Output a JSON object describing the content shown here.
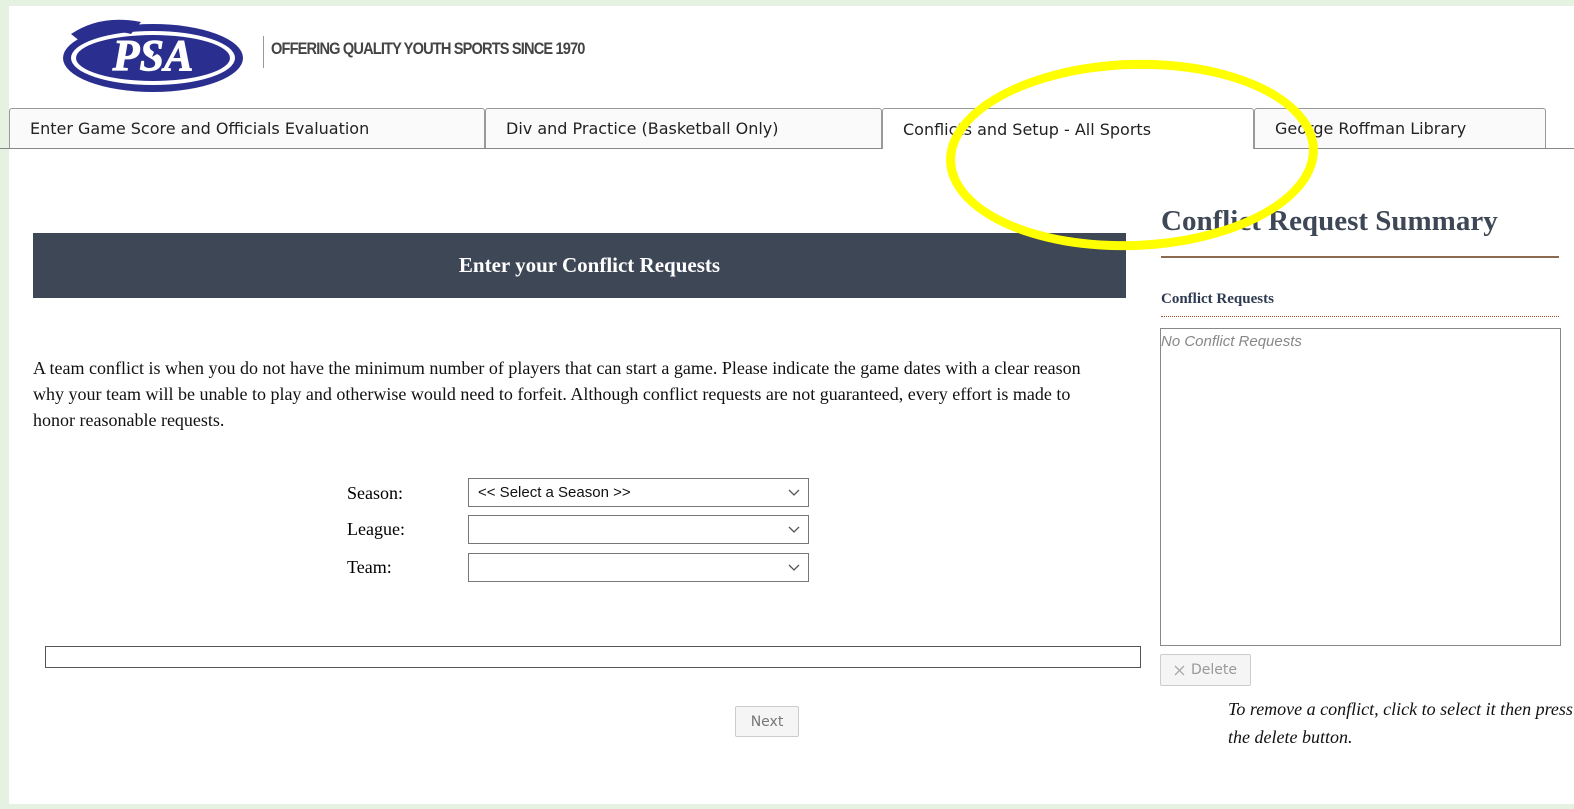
{
  "header": {
    "logo_text": "PSA",
    "tagline": "OFFERING QUALITY YOUTH SPORTS SINCE 1970"
  },
  "tabs": [
    {
      "label": "Enter Game Score and Officials Evaluation",
      "active": false
    },
    {
      "label": "Div and Practice (Basketball Only)",
      "active": false
    },
    {
      "label": "Conflicts and Setup - All Sports",
      "active": true
    },
    {
      "label": "George Roffman Library",
      "active": false
    }
  ],
  "main": {
    "panel_title": "Enter your Conflict Requests",
    "intro": "A team conflict is when you do not have the minimum number of players that can start a game. Please indicate the game dates with a clear reason why your team will be unable to play and otherwise would need to forfeit. Although conflict requests are not guaranteed, every effort is made to honor reasonable requests.",
    "form": {
      "season_label": "Season:",
      "season_value": "<< Select a Season >>",
      "league_label": "League:",
      "league_value": "",
      "team_label": "Team:",
      "team_value": ""
    },
    "progress_fraction": 0,
    "next_label": "Next"
  },
  "summary": {
    "title": "Conflict Request Summary",
    "list_label": "Conflict Requests",
    "empty_text": "No Conflict Requests",
    "delete_label": "Delete",
    "hint": "To remove a conflict, click to select it then press the delete button."
  },
  "colors": {
    "panel_header_bg": "#3e4756",
    "annotation": "#ffff00",
    "frame": "#e6f2e1"
  }
}
